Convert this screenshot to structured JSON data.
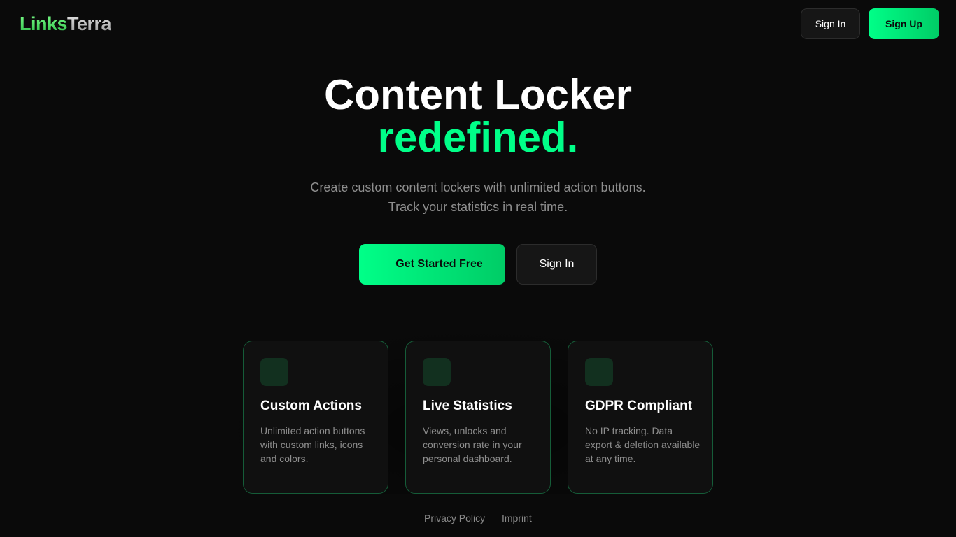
{
  "header": {
    "logo_part1": "Links",
    "logo_part2": "Terra",
    "signin_label": "Sign In",
    "signup_label": "Sign Up"
  },
  "hero": {
    "title": "Content Locker",
    "title_accent": "redefined.",
    "subtitle_line1": "Create custom content lockers with unlimited action buttons.",
    "subtitle_line2": "Track your statistics in real time.",
    "cta_primary": "Get Started Free",
    "cta_secondary": "Sign In"
  },
  "features": [
    {
      "title": "Custom Actions",
      "description": "Unlimited action buttons with custom links, icons and colors."
    },
    {
      "title": "Live Statistics",
      "description": "Views, unlocks and conversion rate in your personal dashboard."
    },
    {
      "title": "GDPR Compliant",
      "description": "No IP tracking. Data export & deletion available at any time."
    }
  ],
  "footer": {
    "privacy_label": "Privacy Policy",
    "imprint_label": "Imprint"
  },
  "colors": {
    "accent": "#00ff88",
    "background": "#0a0a0a",
    "card_border": "#155c38"
  }
}
